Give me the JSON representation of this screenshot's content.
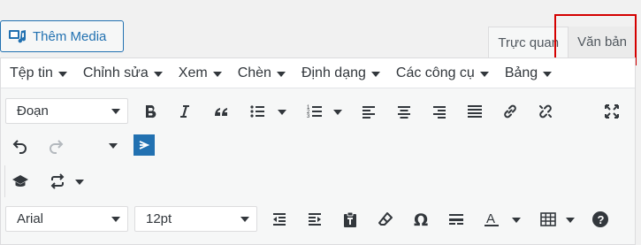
{
  "add_media": {
    "label": "Thêm Media"
  },
  "tabs": {
    "visual": "Trực quan",
    "text": "Văn bản"
  },
  "menubar": [
    {
      "label": "Tệp tin"
    },
    {
      "label": "Chỉnh sửa"
    },
    {
      "label": "Xem"
    },
    {
      "label": "Chèn"
    },
    {
      "label": "Định dạng"
    },
    {
      "label": "Các công cụ"
    },
    {
      "label": "Bảng"
    }
  ],
  "toolbar1": {
    "format_select": "Đoạn"
  },
  "toolbar4": {
    "font_family": "Arial",
    "font_size": "12pt"
  },
  "colors": {
    "accent": "#2271b1",
    "highlight": "#d40000"
  },
  "icons": [
    "bold-icon",
    "italic-icon",
    "blockquote-icon",
    "bullet-list-icon",
    "numbered-list-icon",
    "align-left-icon",
    "align-center-icon",
    "align-right-icon",
    "justify-icon",
    "link-icon",
    "unlink-icon",
    "fullscreen-icon",
    "undo-icon",
    "redo-icon",
    "ltr-icon",
    "learnpress-icon",
    "shortcode-icon",
    "outdent-icon",
    "indent-icon",
    "paste-text-icon",
    "clear-format-icon",
    "omega-icon",
    "horizontal-line-icon",
    "text-color-icon",
    "table-icon",
    "help-icon"
  ]
}
